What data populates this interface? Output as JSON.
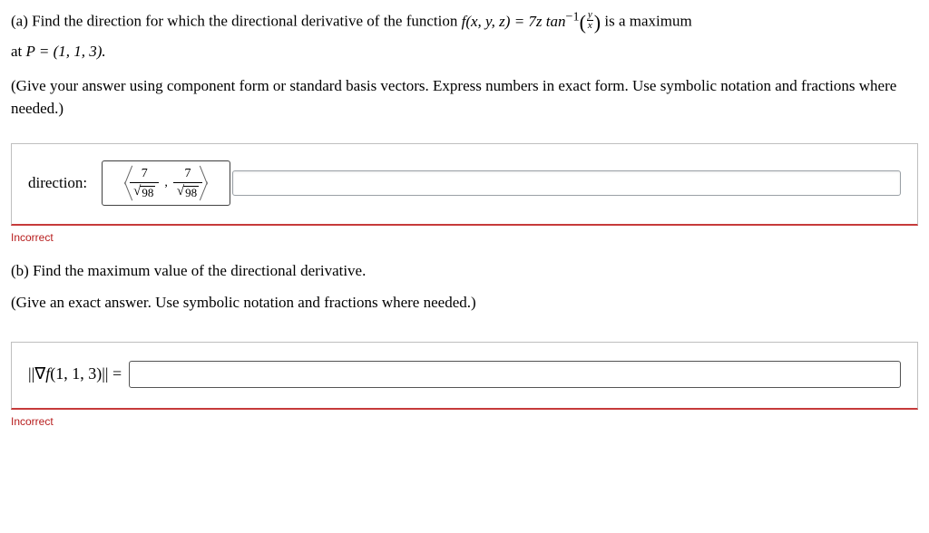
{
  "partA": {
    "prompt_prefix": "(a) Find the direction for which the directional derivative of the function ",
    "func_lhs": "f(x, y, z) = 7z tan",
    "func_exp": "−1",
    "arg_num": "y",
    "arg_den": "x",
    "prompt_suffix_1": " is a maximum",
    "prompt_line2_prefix": "at ",
    "point": "P = (1, 1, 3).",
    "instructions": "(Give your answer using component form or standard basis vectors. Express numbers in exact form. Use symbolic notation and fractions where needed.)",
    "answer_label": "direction:",
    "answer": {
      "term1_num": "7",
      "term1_den_rad": "98",
      "sep": ",",
      "term2_num": "7",
      "term2_den_rad": "98"
    },
    "feedback": "Incorrect"
  },
  "partB": {
    "prompt": "(b) Find the maximum value of the directional derivative.",
    "instructions": "(Give an exact answer. Use symbolic notation and fractions where needed.)",
    "lhs": "||∇f(1, 1, 3)|| =",
    "value": "",
    "feedback": "Incorrect"
  }
}
